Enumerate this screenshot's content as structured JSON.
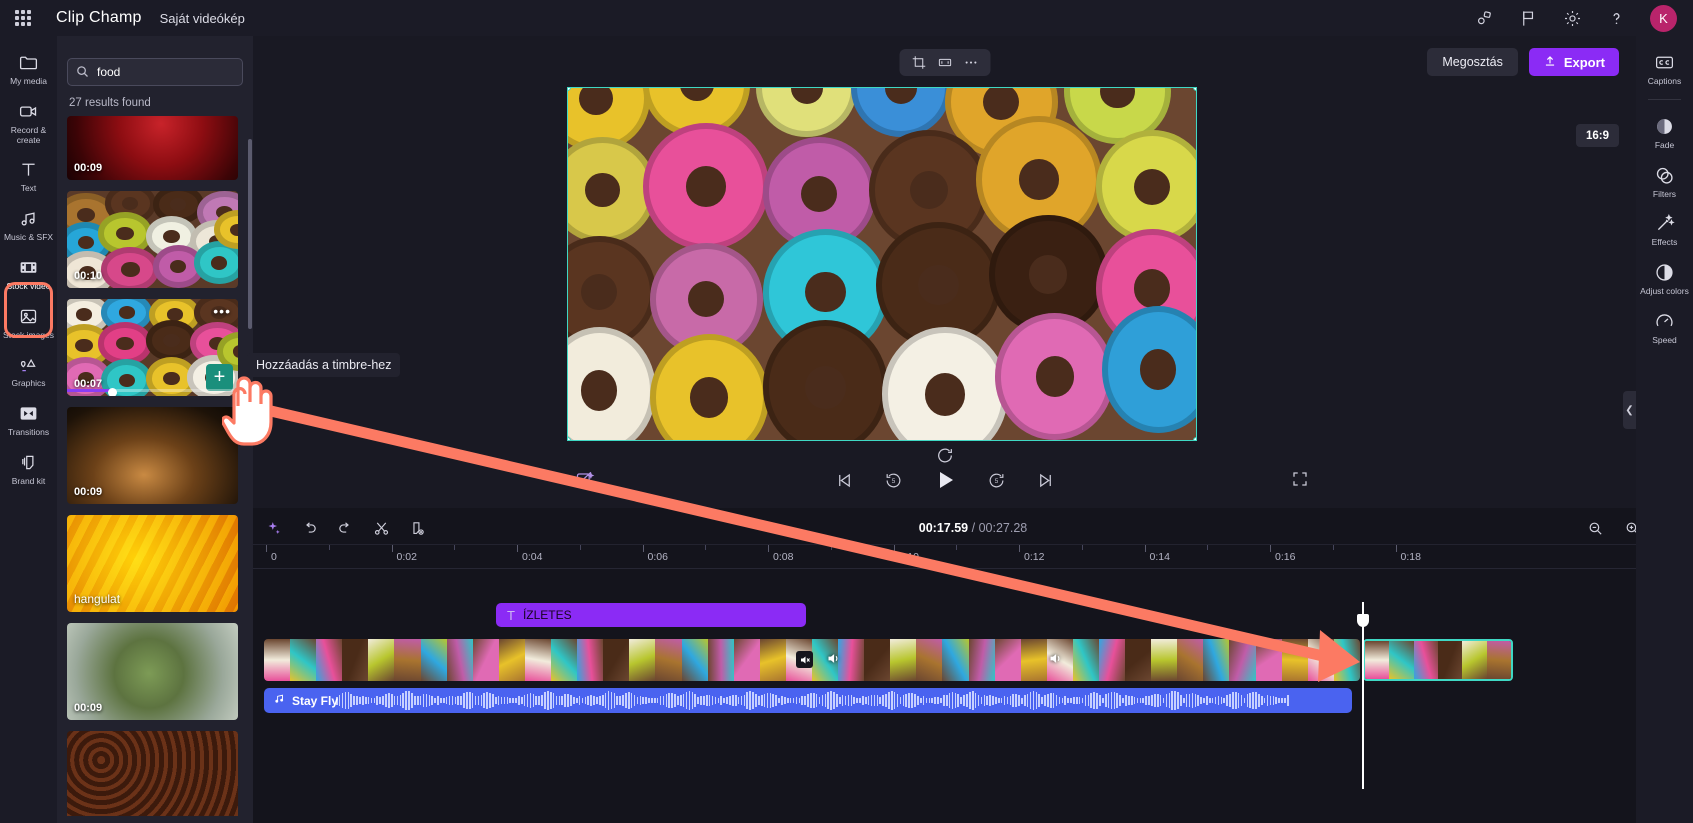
{
  "app": {
    "brand": "Clip Champ",
    "project_name": "Saját videókép",
    "waffle_icon": "grid-apps-icon",
    "header_icons": [
      "integrations-icon",
      "flag-icon",
      "gear-icon",
      "help-icon"
    ],
    "avatar_initial": "K",
    "accent_purple": "#8b2bf5",
    "accent_teal": "#3fd8c4",
    "highlight_orange": "#fc7a63",
    "avatar_color": "#b9246b"
  },
  "rail": {
    "items": [
      {
        "label": "My media",
        "icon": "folder-icon",
        "active": false
      },
      {
        "label": "Record & create",
        "icon": "record-camera-icon",
        "active": false
      },
      {
        "label": "Text",
        "icon": "text-t-icon",
        "active": false
      },
      {
        "label": "Music & SFX",
        "icon": "music-note-icon",
        "active": false
      },
      {
        "label": "Stock video",
        "icon": "film-strip-icon",
        "active": true
      },
      {
        "label": "Stock images",
        "icon": "image-icon",
        "active": false
      },
      {
        "label": "Graphics",
        "icon": "shapes-icon",
        "active": false
      },
      {
        "label": "Transitions",
        "icon": "transitions-icon",
        "active": false
      },
      {
        "label": "Brand kit",
        "icon": "brand-kit-icon",
        "active": false
      }
    ]
  },
  "panel": {
    "search": {
      "value": "food",
      "placeholder": "Search",
      "icon": "search-icon"
    },
    "results_text": "27 results found",
    "add_button_label": "+",
    "more_menu_icon": "more-dots-icon",
    "thumbnails": [
      {
        "badge": "00:09",
        "art": "red",
        "type": "duration"
      },
      {
        "badge": "00:10",
        "art": "donuts-a",
        "type": "duration"
      },
      {
        "badge": "00:07",
        "art": "donuts-b",
        "type": "duration"
      },
      {
        "badge": "00:09",
        "art": "steam",
        "type": "duration"
      },
      {
        "badge": "hangulat",
        "art": "honey",
        "type": "word"
      },
      {
        "badge": "00:09",
        "art": "olive",
        "type": "duration"
      },
      {
        "badge": "",
        "art": "coffee",
        "type": "duration"
      }
    ]
  },
  "preview": {
    "float_tools": [
      "crop-icon",
      "fit-icon",
      "more-dots-icon"
    ],
    "share_label": "Megosztás",
    "export_label": "Export",
    "export_icon": "upload-icon",
    "aspect_ratio": "16:9",
    "rotate_icon": "rotate-icon",
    "controls": [
      "skip-start-icon",
      "rewind-5-icon",
      "play-icon",
      "forward-5-icon",
      "skip-end-icon"
    ],
    "left_tool_icon": "no-background-icon",
    "fullscreen_icon": "fullscreen-icon",
    "collapse_icon": "chevron-left-icon",
    "panel_toggle_icon": "chevron-down-icon"
  },
  "timeline": {
    "toolbar_icons": [
      "magic-sparkle-icon",
      "undo-icon",
      "redo-icon",
      "scissors-icon",
      "split-icon"
    ],
    "current_time": "00:17.59",
    "total_time": "00:27.28",
    "time_separator": "/",
    "right_icons": [
      "zoom-out-icon",
      "zoom-in-icon",
      "fit-timeline-icon"
    ],
    "ruler_labels": [
      "0",
      "0:02",
      "0:04",
      "0:06",
      "0:08",
      "0:10",
      "0:12",
      "0:14",
      "0:16",
      "0:18"
    ],
    "playhead_time": "0:17.59",
    "clips": {
      "text_clip": {
        "label": "ÍZLETES",
        "icon": "text-t-icon"
      },
      "video_clip_main": {
        "label": ""
      },
      "video_clip_selected": {
        "label": ""
      },
      "audio_clip": {
        "label": "Stay Fly",
        "icon": "music-note-icon"
      },
      "mute_icon": "mute-icon",
      "speaker_icon": "speaker-icon"
    }
  },
  "right_rail": {
    "items": [
      {
        "label": "Captions",
        "icon": "closed-captions-icon"
      },
      {
        "label": "Fade",
        "icon": "fade-icon"
      },
      {
        "label": "Filters",
        "icon": "filters-icon"
      },
      {
        "label": "Effects",
        "icon": "effects-wand-icon"
      },
      {
        "label": "Adjust colors",
        "icon": "adjust-colors-icon"
      },
      {
        "label": "Speed",
        "icon": "speed-gauge-icon"
      }
    ]
  },
  "annotations": {
    "tooltip_text": "Hozzáadás a timbre-hez",
    "cursor_icon": "hand-pointer-icon",
    "arrow_icon": "arrow-annotation",
    "arrow_color": "#fc7a63"
  }
}
